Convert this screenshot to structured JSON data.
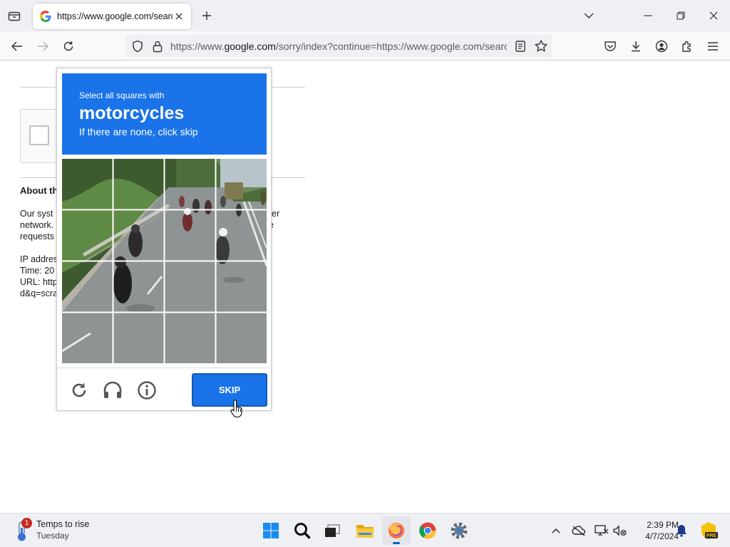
{
  "browser": {
    "tab": {
      "title": "https://www.google.com/search",
      "favicon": "google-g-icon"
    },
    "url": {
      "prefix": "https://www.",
      "host": "google.com",
      "path": "/sorry/index?continue=https://www.google.com/search"
    },
    "icons": {
      "tab_list": "tab-list-icon",
      "new_tab": "plus-icon",
      "tabs_menu": "chevron-down-icon",
      "minimize": "minimize-icon",
      "restore": "restore-icon",
      "close": "close-icon",
      "back": "back-arrow-icon",
      "forward": "forward-arrow-icon",
      "reload": "reload-icon",
      "tracking": "shield-icon",
      "lock": "lock-icon",
      "reader": "reader-view-icon",
      "bookmark": "star-icon",
      "pocket": "pocket-icon",
      "downloads": "download-icon",
      "account": "account-icon",
      "extensions": "extensions-icon",
      "menu": "hamburger-menu-icon"
    }
  },
  "page": {
    "about_title": "About th",
    "paragraph_lines": [
      "Our syst",
      "network.",
      "requests"
    ],
    "paragraph_tail": [
      "er",
      "e"
    ],
    "info_lines": [
      "IP addres",
      "Time: 20",
      "URL: http",
      "d&q=scra"
    ]
  },
  "captcha": {
    "instruction": "Select all squares with",
    "target": "motorcycles",
    "hint": "If there are none, click skip",
    "skip_label": "SKIP",
    "grid": {
      "rows": 4,
      "cols": 4
    },
    "footer_icons": [
      "reload-icon",
      "headphones-icon",
      "info-icon"
    ]
  },
  "taskbar": {
    "weather": {
      "title": "Temps to rise",
      "subtitle": "Tuesday",
      "badge": "1"
    },
    "apps": [
      "windows-start-icon",
      "search-icon",
      "task-view-icon",
      "file-explorer-icon",
      "firefox-icon",
      "chrome-icon",
      "settings-icon"
    ],
    "active_app": "firefox-icon",
    "clock": {
      "time": "2:39 PM",
      "date": "4/7/2024"
    },
    "tray": [
      "chevron-up-icon",
      "onedrive-icon",
      "display-icon",
      "sound-muted-icon",
      "notifications-icon",
      "preview-badge-icon"
    ],
    "preview_badge": "PRE"
  },
  "colors": {
    "captcha_blue": "#1a73e8",
    "tab_strip": "#f0f0f4",
    "taskbar": "#eef0f4"
  }
}
